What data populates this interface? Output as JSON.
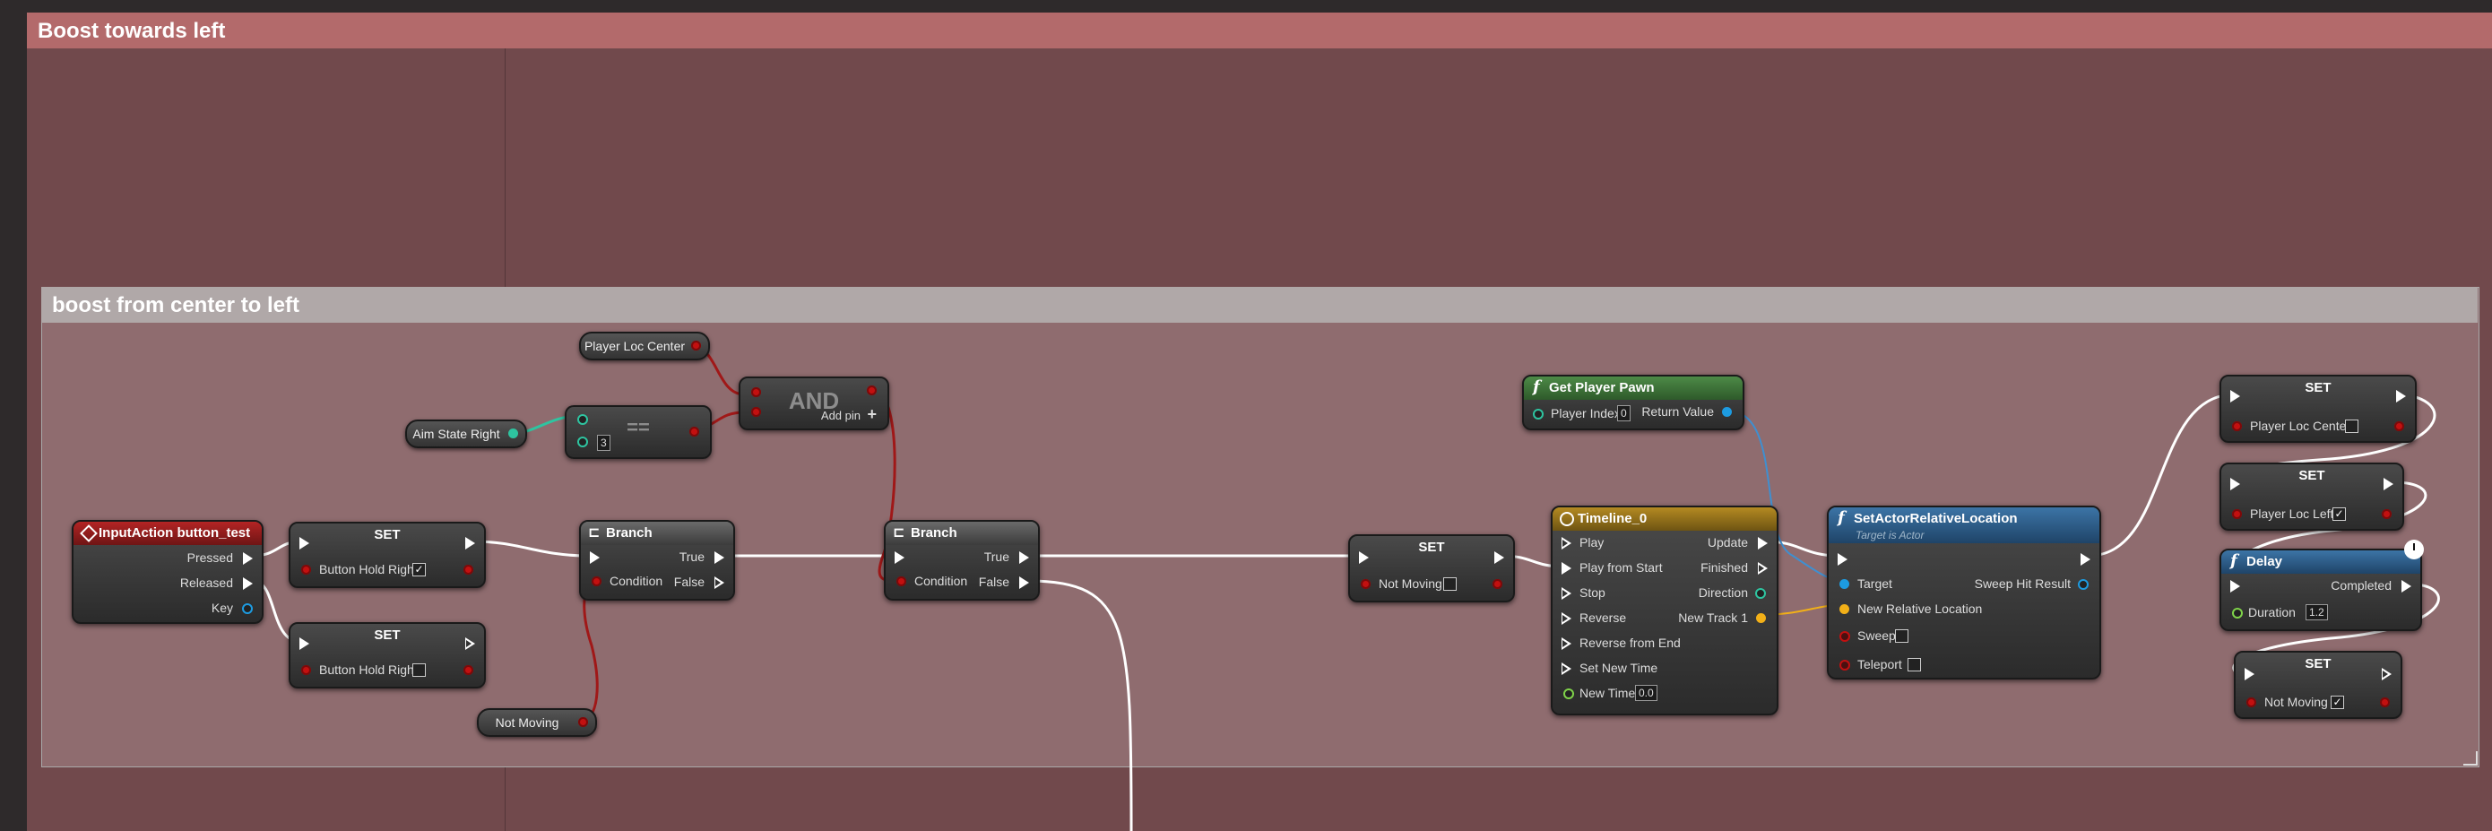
{
  "comments": {
    "outer_title": "Boost towards left",
    "inner_title": "boost from center to left"
  },
  "nodes": {
    "input_action": {
      "title": "InputAction button_test",
      "pressed": "Pressed",
      "released": "Released",
      "key": "Key"
    },
    "set_hold_true": {
      "title": "SET",
      "var": "Button Hold Right",
      "checked": "✓"
    },
    "set_hold_false": {
      "title": "SET",
      "var": "Button Hold Right"
    },
    "aim_state_right": {
      "label": "Aim State Right"
    },
    "equals": {
      "title": "==",
      "value": "3"
    },
    "player_loc_center_get": {
      "label": "Player Loc Center"
    },
    "and": {
      "title": "AND",
      "add_pin": "Add pin"
    },
    "branch1": {
      "title": "Branch",
      "true": "True",
      "false": "False",
      "condition": "Condition"
    },
    "not_moving_get": {
      "label": "Not Moving"
    },
    "branch2": {
      "title": "Branch",
      "true": "True",
      "false": "False",
      "condition": "Condition"
    },
    "set_not_moving": {
      "title": "SET",
      "var": "Not Moving"
    },
    "get_player_pawn": {
      "title": "Get Player Pawn",
      "player_index": "Player Index",
      "index_value": "0",
      "return_value": "Return Value"
    },
    "timeline": {
      "title": "Timeline_0",
      "play": "Play",
      "play_from_start": "Play from Start",
      "stop": "Stop",
      "reverse": "Reverse",
      "reverse_from_end": "Reverse from End",
      "set_new_time": "Set New Time",
      "new_time": "New Time",
      "new_time_value": "0.0",
      "update": "Update",
      "finished": "Finished",
      "direction": "Direction",
      "new_track": "New Track 1"
    },
    "set_actor_rel_loc": {
      "title": "SetActorRelativeLocation",
      "subtitle": "Target is Actor",
      "target": "Target",
      "new_rel_loc": "New Relative Location",
      "sweep": "Sweep",
      "teleport": "Teleport",
      "sweep_hit": "Sweep Hit Result"
    },
    "set_loc_center": {
      "title": "SET",
      "var": "Player Loc Center"
    },
    "set_loc_left": {
      "title": "SET",
      "var": "Player Loc Left",
      "checked": "✓"
    },
    "delay": {
      "title": "Delay",
      "duration": "Duration",
      "duration_value": "1.2",
      "completed": "Completed"
    },
    "set_not_moving2": {
      "title": "SET",
      "var": "Not Moving",
      "checked": "✓"
    }
  },
  "colors": {
    "exec_wire": "#ffffff",
    "bool_wire": "#a01818",
    "int_wire": "#2ec4a0",
    "object_wire": "#3f8fd0",
    "vector_wire": "#f2b018",
    "event_header": "#a02020",
    "function_header": "#2c5a86",
    "pure_function_header": "#3f7a3a",
    "timeline_header": "#a07a1a"
  }
}
